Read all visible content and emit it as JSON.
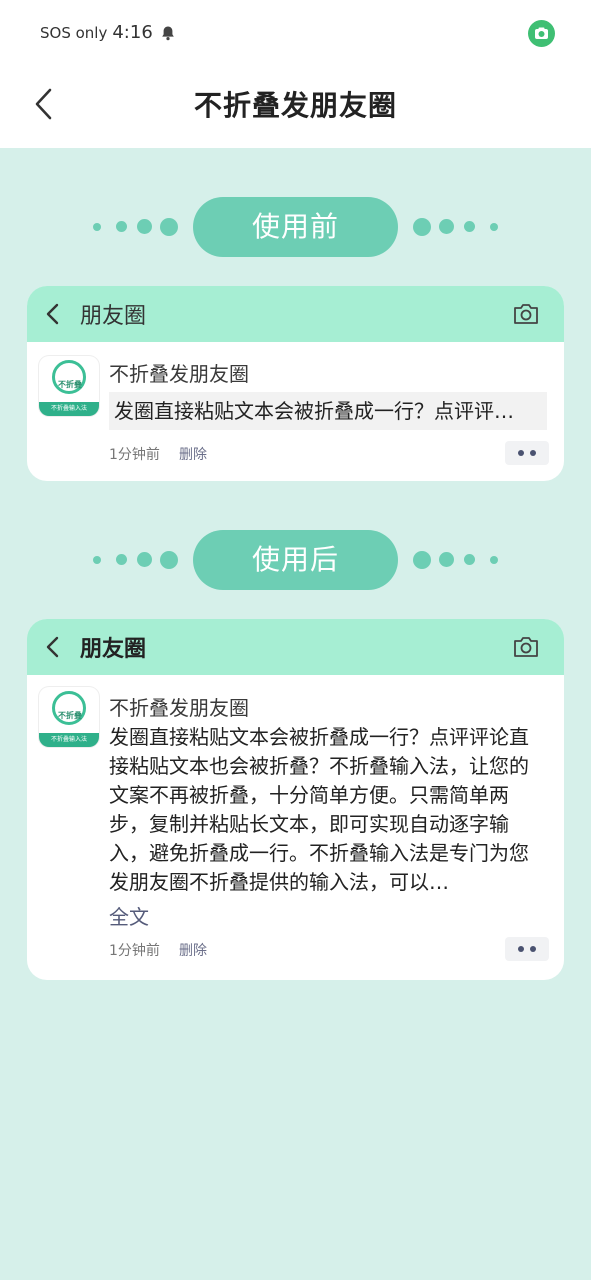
{
  "status_bar": {
    "sos": "SOS only",
    "time": "4:16"
  },
  "nav": {
    "title": "不折叠发朋友圈"
  },
  "before": {
    "label": "使用前",
    "card": {
      "title": "朋友圈",
      "name": "不折叠发朋友圈",
      "snippet": "发圈直接粘贴文本会被折叠成一行？点评评…",
      "time": "1分钟前",
      "delete": "删除"
    }
  },
  "after": {
    "label": "使用后",
    "card": {
      "title": "朋友圈",
      "name": "不折叠发朋友圈",
      "body": "发圈直接粘贴文本会被折叠成一行？点评评论直接粘贴文本也会被折叠？不折叠输入法，让您的文案不再被折叠，十分简单方便。只需简单两步，复制并粘贴长文本，即可实现自动逐字输入，避免折叠成一行。不折叠输入法是专门为您发朋友圈不折叠提供的输入法，可以…",
      "full_text": "全文",
      "time": "1分钟前",
      "delete": "删除"
    }
  },
  "avatar": {
    "main": "不折叠",
    "band": "不折叠输入法"
  },
  "colors": {
    "background": "#d6f0ea",
    "accent": "#6dceb4",
    "card_header": "#a6eed3",
    "status_camera": "#3fbf73"
  },
  "icons": {
    "back": "chevron-left-icon",
    "camera": "camera-icon",
    "bell": "bell-icon",
    "more": "more-dots-icon"
  }
}
